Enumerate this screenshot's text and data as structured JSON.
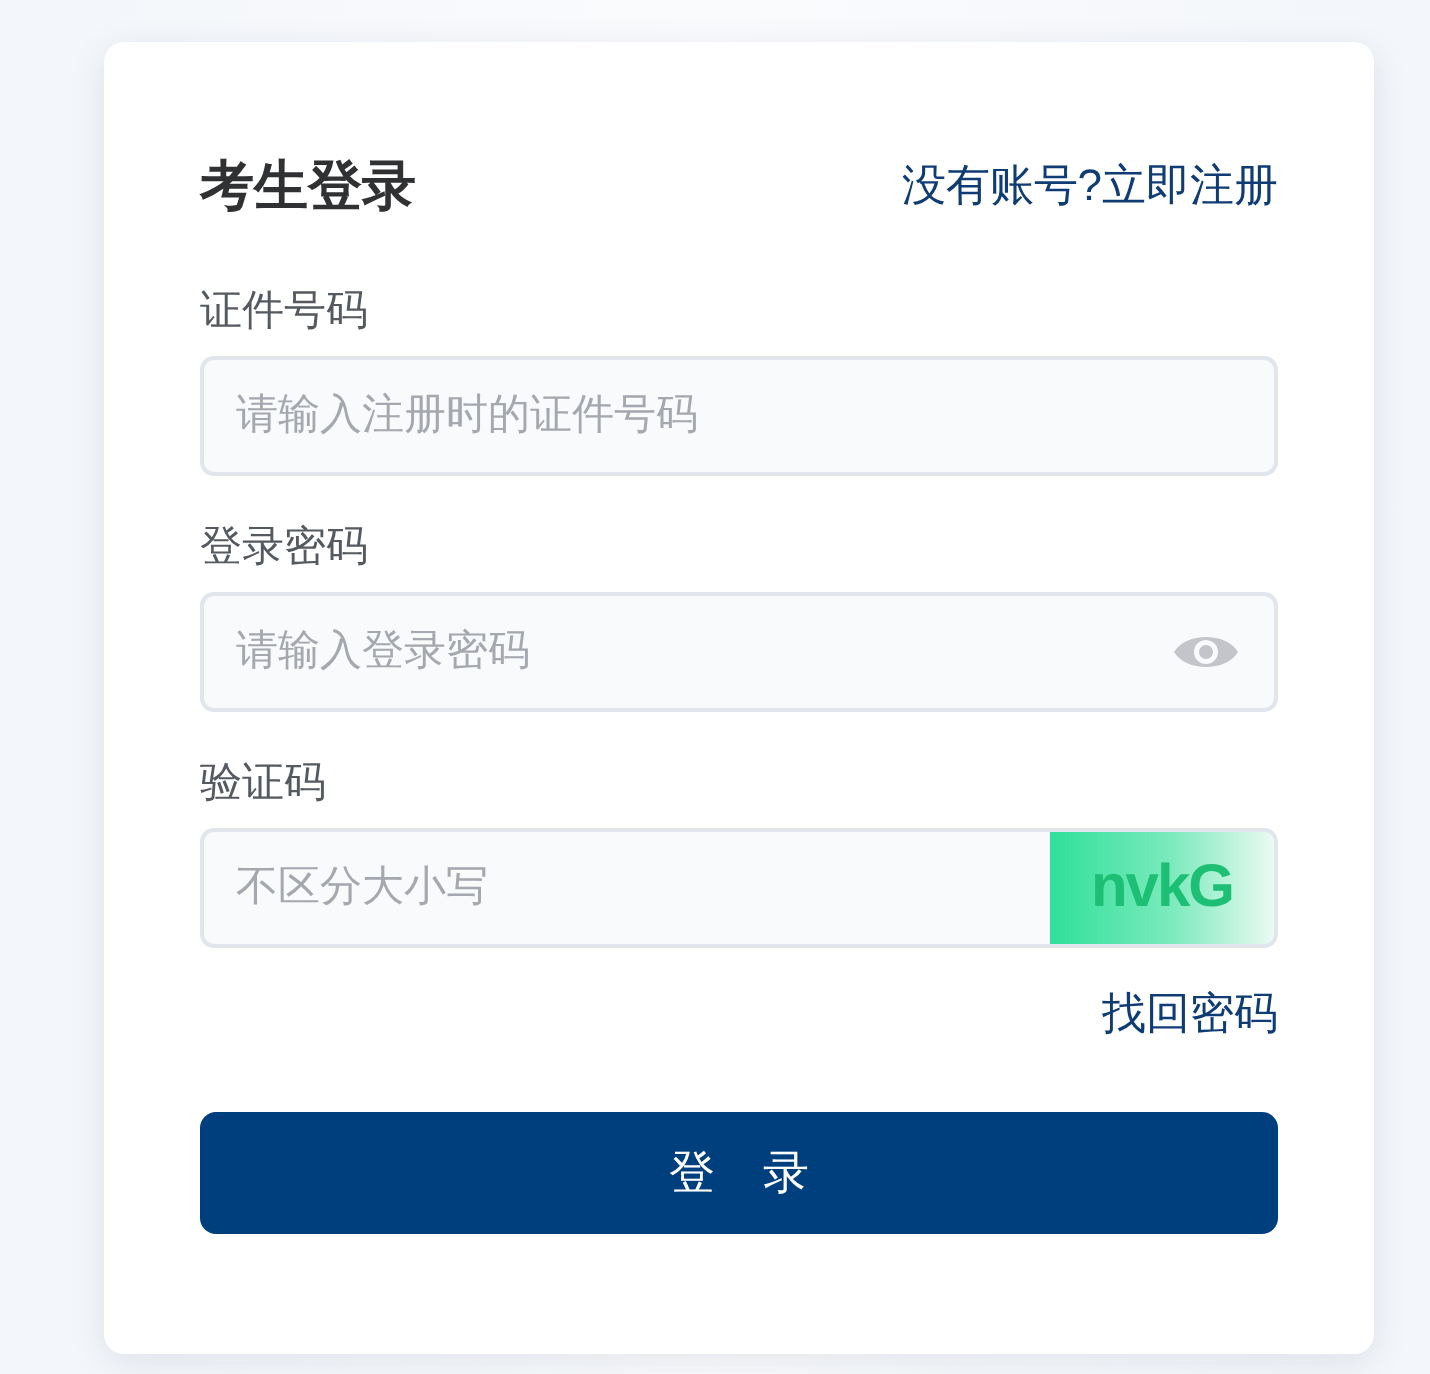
{
  "title": "考生登录",
  "register_link": "没有账号?立即注册",
  "fields": [
    {
      "kind": "text",
      "label": "证件号码",
      "placeholder": "请输入注册时的证件号码"
    },
    {
      "kind": "password",
      "label": "登录密码",
      "placeholder": "请输入登录密码"
    },
    {
      "kind": "captcha",
      "label": "验证码",
      "placeholder": "不区分大小写",
      "captcha": "nvkG"
    }
  ],
  "forgot_link": "找回密码",
  "submit_button": "登 录"
}
